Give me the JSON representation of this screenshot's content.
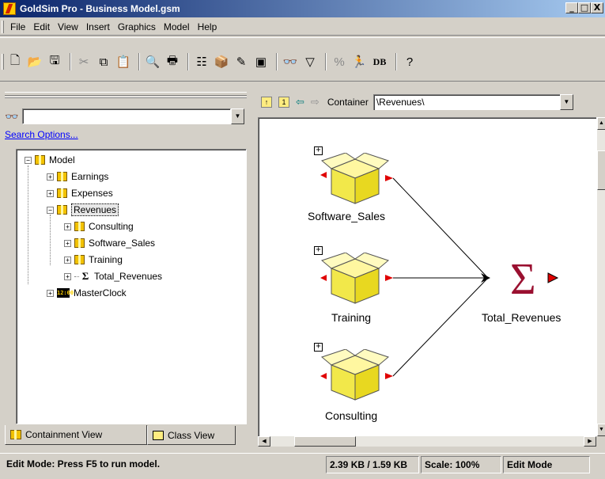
{
  "window": {
    "title": "GoldSim Pro - Business Model.gsm",
    "buttons": {
      "minimize": "_",
      "restore": "□",
      "close": "X"
    }
  },
  "menu": {
    "items": [
      "File",
      "Edit",
      "View",
      "Insert",
      "Graphics",
      "Model",
      "Help"
    ]
  },
  "toolbar": {
    "db_label": "DB"
  },
  "search": {
    "value": "",
    "options_link": "Search Options..."
  },
  "tree": {
    "root": "Model",
    "nodes": [
      "Earnings",
      "Expenses",
      "Revenues",
      "Consulting",
      "Software_Sales",
      "Training",
      "Total_Revenues",
      "MasterClock"
    ],
    "clock_icon_text": "12:00",
    "selected": "Revenues"
  },
  "tabs": {
    "containment": "Containment View",
    "class": "Class View"
  },
  "navigation": {
    "label": "Container",
    "path": "\\Revenues\\"
  },
  "canvas": {
    "elements": [
      "Software_Sales",
      "Training",
      "Consulting",
      "Total_Revenues"
    ]
  },
  "status": {
    "mode_hint": "Edit Mode: Press F5 to run model.",
    "file_size": "2.39 KB / 1.59 KB",
    "scale": "Scale: 100%",
    "mode": "Edit Mode"
  },
  "colors": {
    "titlebar_start": "#0a246a",
    "titlebar_end": "#a6caf0",
    "container_yellow": "#f2e84a",
    "port_red": "#e00000",
    "sigma": "#9a1030",
    "link": "#0000ff"
  }
}
